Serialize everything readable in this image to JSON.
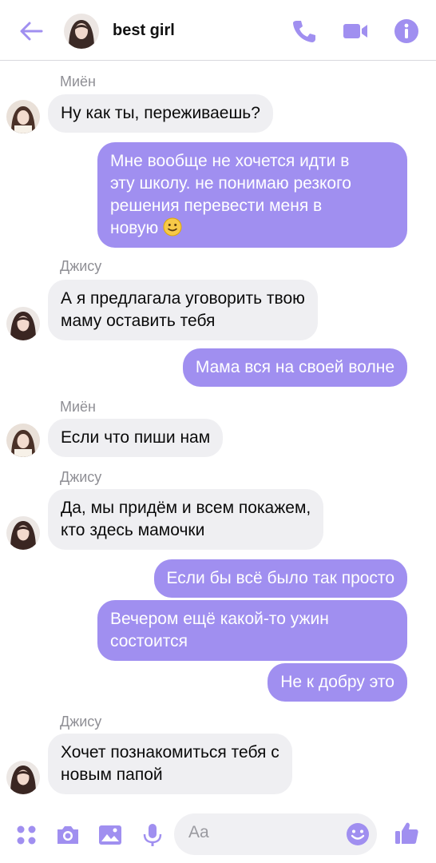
{
  "header": {
    "title": "best girl",
    "back_icon": "arrow-left-icon",
    "call_icon": "phone-icon",
    "video_icon": "video-camera-icon",
    "info_icon": "info-icon",
    "accent": "#a08ff0"
  },
  "messages": [
    {
      "sender": "Миён",
      "text": "Ну как ты, переживаешь?"
    },
    {
      "text": "Мне вообще не хочется идти в\nэту школу. не понимаю резкого\nрешения перевести меня в\nновую",
      "emoji": "slightly-smiling-face-icon"
    },
    {
      "sender": "Джису",
      "text": "А я предлагала уговорить твою\nмаму оставить тебя"
    },
    {
      "text": "Мама вся на своей волне"
    },
    {
      "sender": "Миён",
      "text": "Если что пиши нам"
    },
    {
      "sender": "Джису",
      "text": "Да, мы придём и всем покажем,\nкто здесь мамочки"
    },
    {
      "text": "Если бы всё было так просто"
    },
    {
      "text": "Вечером ещё какой-то ужин\nсостоится"
    },
    {
      "text": "Не к добру это"
    },
    {
      "sender": "Джису",
      "text": "Хочет познакомиться тебя с\nновым папой"
    }
  ],
  "composer": {
    "placeholder": "Aa",
    "icons": [
      "grid-dots-icon",
      "camera-icon",
      "image-icon",
      "microphone-icon",
      "emoji-icon",
      "thumbs-up-icon"
    ]
  },
  "colors": {
    "outgoing_bubble": "#a08ff0",
    "incoming_bubble": "#efeff2",
    "sender_label": "#8f8f95"
  }
}
